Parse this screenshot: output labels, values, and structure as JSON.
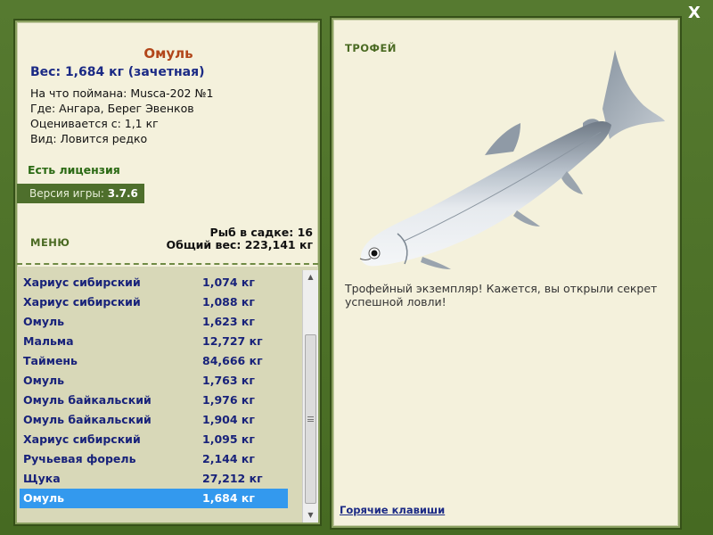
{
  "close_label": "X",
  "fish": {
    "name": "Омуль",
    "weight": "Вес: 1,684 кг (зачетная)",
    "caught_on": "На что поймана: Musca-202 №1",
    "where": "Где: Ангара, Берег Эвенков",
    "rated_from": "Оценивается с: 1,1 кг",
    "kind": "Вид: Ловится редко"
  },
  "license": "Есть лицензия",
  "version": {
    "label": "Версия игры:",
    "value": "3.7.6"
  },
  "menu_label": "МЕНЮ",
  "cage": {
    "count": "Рыб в садке: 16",
    "total": "Общий вес: 223,141 кг"
  },
  "catch_list": [
    {
      "name": "Хариус сибирский",
      "weight": "1,074 кг"
    },
    {
      "name": "Хариус сибирский",
      "weight": "1,088 кг"
    },
    {
      "name": "Омуль",
      "weight": "1,623 кг"
    },
    {
      "name": "Мальма",
      "weight": "12,727 кг"
    },
    {
      "name": "Таймень",
      "weight": "84,666 кг"
    },
    {
      "name": "Омуль",
      "weight": "1,763 кг"
    },
    {
      "name": "Омуль байкальский",
      "weight": "1,976 кг"
    },
    {
      "name": "Омуль байкальский",
      "weight": "1,904 кг"
    },
    {
      "name": "Хариус сибирский",
      "weight": "1,095 кг"
    },
    {
      "name": "Ручьевая форель",
      "weight": "2,144 кг"
    },
    {
      "name": "Щука",
      "weight": "27,212 кг"
    },
    {
      "name": "Омуль",
      "weight": "1,684 кг",
      "selected": true
    }
  ],
  "trophy": {
    "label": "ТРОФЕЙ",
    "text": "Трофейный экземпляр! Кажется, вы открыли секрет успешной ловли!",
    "image": "omul-fish-illustration"
  },
  "hotkeys_label": "Горячие клавиши",
  "colors": {
    "frame": "#4a6a2a",
    "panel": "#f4f1dc",
    "fish_name": "#b2461a",
    "accent_green": "#2b6a14",
    "list_text": "#18227a",
    "selection": "#3399ee"
  }
}
